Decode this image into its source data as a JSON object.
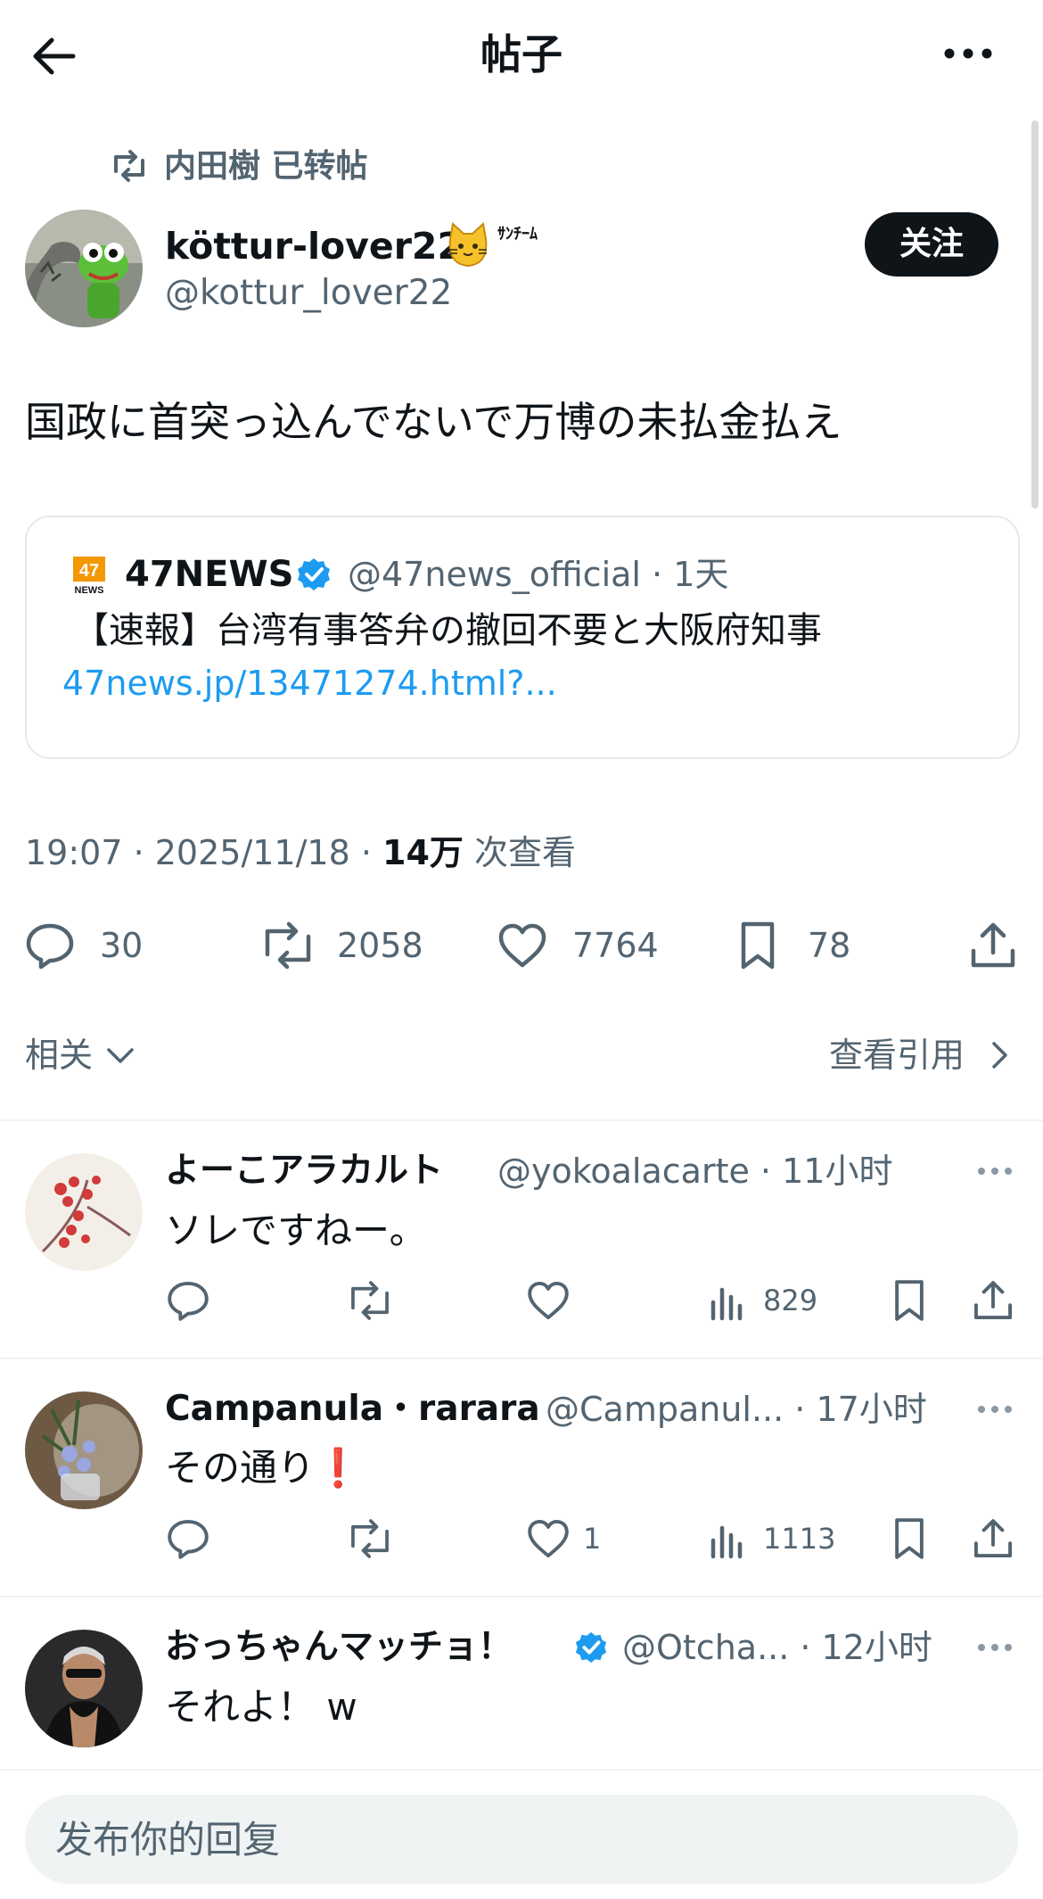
{
  "header": {
    "title": "帖子"
  },
  "repost": {
    "text": "内田樹 已转帖"
  },
  "author": {
    "name": "köttur-lover22",
    "badge_text": "ｻﾝﾁｰﾑ",
    "handle": "@kottur_lover22",
    "follow_label": "关注"
  },
  "tweet": {
    "text": "国政に首突っ込んでないで万博の未払金払え"
  },
  "quote": {
    "logo_text": "47",
    "logo_subtext": "NEWS",
    "name": "47NEWS",
    "meta": "@47news_official · 1天",
    "text": "【速報】台湾有事答弁の撤回不要と大阪府知事",
    "link": "47news.jp/13471274.html?..."
  },
  "stats": {
    "time": "19:07 · 2025/11/18 · ",
    "views_bold": "14万",
    "views_suffix": " 次查看"
  },
  "actions": {
    "replies": "30",
    "reposts": "2058",
    "likes": "7764",
    "bookmarks": "78"
  },
  "related": {
    "label": "相关",
    "quotes_label": "查看引用"
  },
  "replies": [
    {
      "name": "よーこアラカルト",
      "meta": "@yokoalacarte · 11小时",
      "text": "ソレですねー。",
      "likes": "",
      "views": "829"
    },
    {
      "name": "Campanula・rarara",
      "meta": "@Campanul... · 17小时",
      "text": "その通り❗",
      "likes": "1",
      "views": "1113"
    },
    {
      "name": "おっちゃんマッチョ！",
      "meta": "@Otcha... · 12小时",
      "text": "それよ！ w",
      "likes": "",
      "views": ""
    }
  ],
  "composer": {
    "placeholder": "发布你的回复"
  },
  "colors": {
    "accent": "#1d9bf0",
    "text": "#0f1419",
    "muted": "#536471",
    "divider": "#eff3f4"
  },
  "icons": [
    "arrow-left-icon",
    "more-icon",
    "repost-icon",
    "verified-icon",
    "reply-icon",
    "like-icon",
    "bookmark-icon",
    "share-icon",
    "views-icon",
    "chevron-down-icon",
    "chevron-right-icon"
  ]
}
